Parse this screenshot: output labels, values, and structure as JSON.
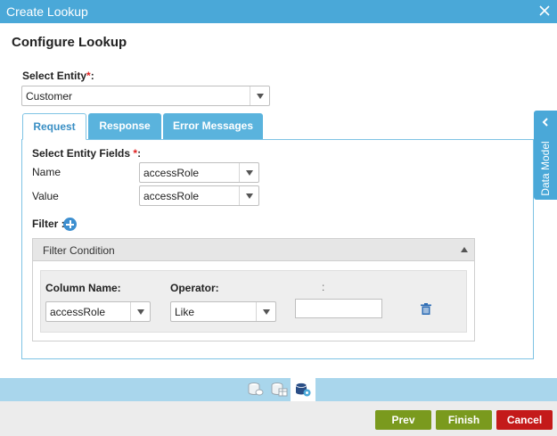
{
  "dialog": {
    "title": "Create Lookup"
  },
  "heading": "Configure Lookup",
  "select_entity": {
    "label": "Select Entity",
    "required_mark": "*",
    "colon": ":",
    "value": "Customer"
  },
  "tabs": [
    {
      "label": "Request",
      "active": true
    },
    {
      "label": "Response",
      "active": false
    },
    {
      "label": "Error Messages",
      "active": false
    }
  ],
  "entity_fields": {
    "label": "Select Entity Fields",
    "required_mark": "*",
    "colon": ":",
    "name_label": "Name",
    "name_value": "accessRole",
    "value_label": "Value",
    "value_value": "accessRole"
  },
  "filter": {
    "label": "Filter :",
    "condition_title": "Filter Condition",
    "column_name_label": "Column Name:",
    "operator_label": "Operator:",
    "value_label": ":",
    "column_value": "accessRole",
    "operator_value": "Like",
    "value_input": ""
  },
  "side_panel": {
    "label": "Data Model"
  },
  "footer": {
    "prev": "Prev",
    "finish": "Finish",
    "cancel": "Cancel"
  },
  "colors": {
    "accent": "#4aa8d8",
    "tab_active_text": "#3a8fc4",
    "green": "#7a9a1e",
    "red": "#c41a1a",
    "required": "#e02020"
  },
  "icons": {
    "close": "close-icon",
    "add_filter": "plus-circle-icon",
    "delete": "trash-icon",
    "collapse": "triangle-up-icon",
    "side_chevron": "chevron-left-icon",
    "bottom": [
      "database-link-icon",
      "database-table-icon",
      "database-settings-icon"
    ]
  }
}
